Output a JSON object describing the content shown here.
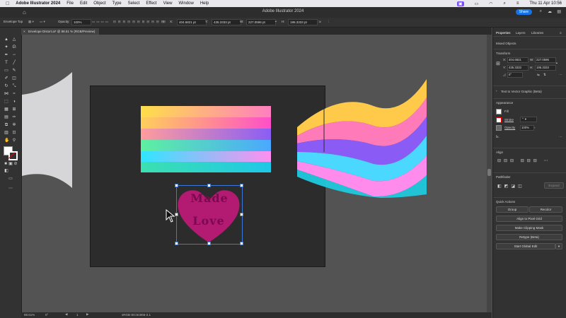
{
  "menubar": {
    "app": "Adobe Illustrator 2024",
    "items": [
      "File",
      "Edit",
      "Object",
      "Type",
      "Select",
      "Effect",
      "View",
      "Window",
      "Help"
    ],
    "clock": "Thu 11 Apr  10:56"
  },
  "titlebar": {
    "title": "Adobe Illustrator 2024",
    "share": "Share"
  },
  "controlbar": {
    "mode": "Envelope Top",
    "opacity_label": "Opacity:",
    "opacity_value": "100%",
    "x_label": "X:",
    "x_value": "404.6821 pt",
    "y_label": "Y:",
    "y_value": "435.3333 pt",
    "w_label": "W:",
    "w_value": "227.0596 pt",
    "h_label": "H:",
    "h_value": "195.3333 pt"
  },
  "tab": {
    "label": "Envelope Distort.ai* @ 88.61 % (RGB/Preview)",
    "close": "×"
  },
  "statusbar": {
    "zoom": "88.61%",
    "rotate": "0°",
    "page": "1",
    "info": "sRGB IEC61966-2.1"
  },
  "panel": {
    "tabs": [
      "Properties",
      "Layers",
      "Libraries"
    ],
    "object_type": "Mixed Objects",
    "transform": {
      "title": "Transform",
      "x_label": "X:",
      "x": "404.6821",
      "y_label": "Y:",
      "y": "435.3333",
      "w_label": "W:",
      "w": "227.0596",
      "h_label": "H:",
      "h": "195.3333",
      "angle": "0°"
    },
    "text_to_vector": "Text to Vector Graphic (Beta)",
    "appearance": {
      "title": "Appearance",
      "fill": "Fill",
      "stroke": "Stroke",
      "opacity": "Opacity",
      "opacity_value": "100%",
      "fx": "fx."
    },
    "align_title": "Align",
    "pathfinder_title": "Pathfinder",
    "expand": "Expand",
    "quick_actions": {
      "title": "Quick Actions",
      "group": "Group",
      "recolor": "Recolor",
      "align_pixel": "Align to Pixel Grid",
      "clipping_mask": "Make Clipping Mask",
      "retype": "Retype (Beta)",
      "global_edit": "Start Global Edit"
    }
  },
  "artwork": {
    "heart_words": [
      "Made",
      "Love"
    ],
    "heart_color": "#c2187a",
    "gradient_stripes": [
      "#ffcf4a",
      "#ff8ab0",
      "#9b5cf0",
      "#2ee6ff",
      "#6de2ff",
      "#22d0d8"
    ]
  }
}
